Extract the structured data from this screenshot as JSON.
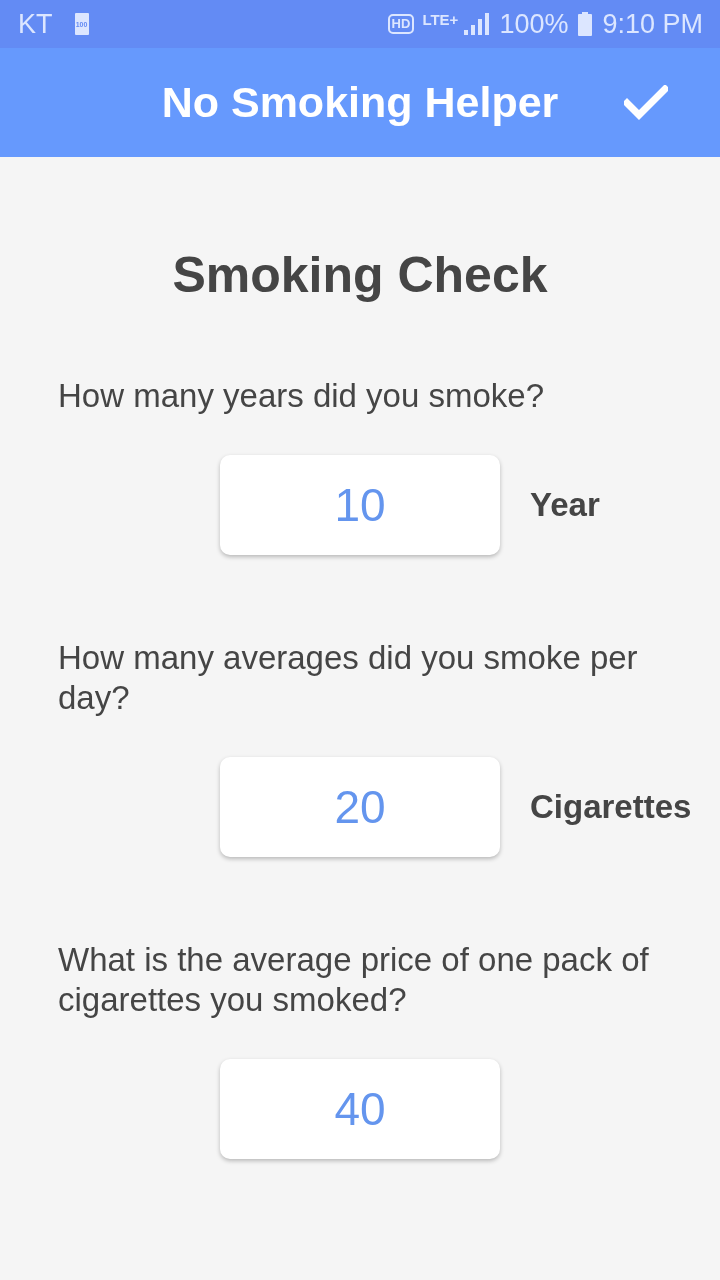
{
  "status_bar": {
    "carrier": "KT",
    "carrier_battery_label": "100",
    "hd_badge": "HD",
    "network_type": "LTE+",
    "battery_percent": "100%",
    "time": "9:10 PM"
  },
  "app_bar": {
    "title": "No Smoking Helper"
  },
  "heading": "Smoking Check",
  "questions": [
    {
      "label": "How many years did you smoke?",
      "value": "10",
      "unit": "Year"
    },
    {
      "label": "How many averages did you smoke per day?",
      "value": "20",
      "unit": "Cigarettes"
    },
    {
      "label": "What is the average price of one pack of cigarettes you smoked?",
      "value": "40"
    }
  ]
}
